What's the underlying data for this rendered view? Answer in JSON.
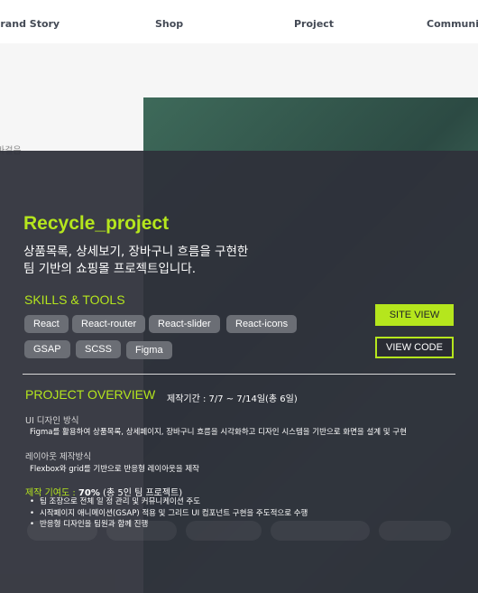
{
  "nav": {
    "items": [
      "Brand Story",
      "Shop",
      "Project",
      "Community"
    ]
  },
  "background": {
    "snippet": "바걸음"
  },
  "project": {
    "title": "Recycle_project",
    "description_line1": "상품목록, 상세보기, 장바구니 흐름을 구현한",
    "description_line2": "팀 기반의 쇼핑몰 프로젝트입니다.",
    "skills_heading": "SKILLS & TOOLS",
    "skills_row1": [
      "React",
      "React-router",
      "React-slider",
      "React-icons"
    ],
    "skills_row2": [
      "GSAP",
      "SCSS",
      "Figma"
    ],
    "site_button": "SITE VIEW",
    "code_button": "VIEW CODE",
    "overview_heading": "PROJECT OVERVIEW",
    "period": "제작기간 : 7/7 ~ 7/14일(총 6일)",
    "ui_design_heading": "UI 디자인 방식",
    "ui_design_text": "Figma를 활용하여 상품목록, 상세페이지, 장바구니 흐름을 시각화하고 디자인 시스템을 기반으로 화면을 설계 및 구현",
    "layout_heading": "레이아웃 제작방식",
    "layout_text": "Flexbox와 grid를 기반으로 반응형  레이아웃을 제작",
    "contribution_label": "제작 기여도 :",
    "contribution_value": "70%",
    "contribution_note": "(총 5인 팀 프로젝트)",
    "contribution_items": [
      "팀 조장으로 전체 일 정 관리 및 커뮤니케이션 주도",
      "시작페이지 애니메이션(GSAP) 적용 및 그리드 UI 컴포넌트 구현을 주도적으로 수행",
      "반응형 디자인을 팀원과 함께 진행"
    ]
  },
  "colors": {
    "accent": "#b5e61d",
    "panel": "#2f313a",
    "chip": "#6b6e75"
  }
}
